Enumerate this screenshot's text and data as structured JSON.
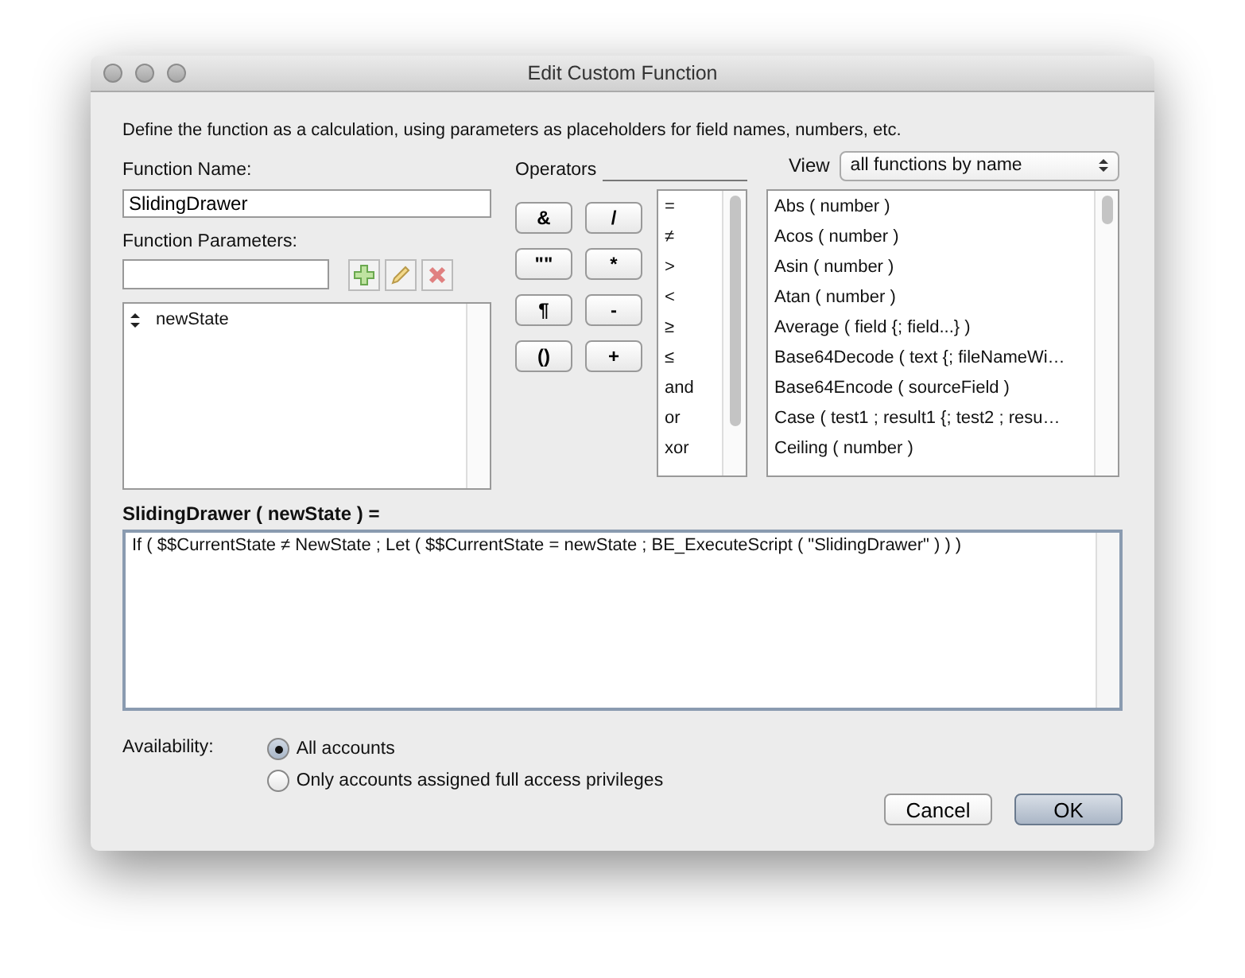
{
  "window": {
    "title": "Edit Custom Function"
  },
  "description": "Define the function as a calculation, using parameters as placeholders for field names, numbers, etc.",
  "function_name": {
    "label": "Function Name:",
    "value": "SlidingDrawer"
  },
  "function_parameters": {
    "label": "Function Parameters:",
    "items": [
      "newState"
    ]
  },
  "operators": {
    "label": "Operators",
    "buttons": [
      "&",
      "/",
      "\"\"",
      "*",
      "¶",
      "-",
      "()",
      "+"
    ],
    "list": [
      "=",
      "≠",
      ">",
      "<",
      "≥",
      "≤",
      "and",
      "or",
      "xor"
    ]
  },
  "view": {
    "label": "View",
    "value": "all functions by name"
  },
  "functions": [
    "Abs ( number )",
    "Acos ( number )",
    "Asin ( number )",
    "Atan ( number )",
    "Average ( field {; field...} )",
    "Base64Decode ( text {; fileNameWi…",
    "Base64Encode ( sourceField )",
    "Case ( test1 ; result1 {; test2 ; resu…",
    "Ceiling ( number )"
  ],
  "formula": {
    "label": "SlidingDrawer ( newState ) =",
    "value": "If ( $$CurrentState ≠ NewState ; Let ( $$CurrentState = newState ; BE_ExecuteScript ( \"SlidingDrawer\" ) ) )"
  },
  "availability": {
    "label": "Availability:",
    "options": [
      {
        "label": "All accounts",
        "selected": true
      },
      {
        "label": "Only accounts assigned full access privileges",
        "selected": false
      }
    ]
  },
  "buttons": [
    {
      "label": "Cancel",
      "kind": "normal"
    },
    {
      "label": "OK",
      "kind": "default"
    }
  ]
}
